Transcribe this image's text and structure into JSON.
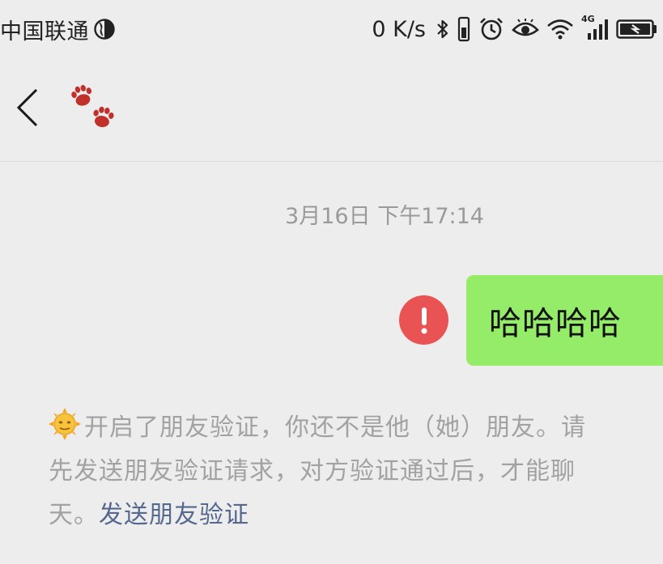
{
  "status_bar": {
    "carrier": "中国联通",
    "net_speed": "0 K/s",
    "network_type": "4G",
    "icons": [
      "globe-icon",
      "bluetooth-icon",
      "vibrate-icon",
      "alarm-icon",
      "eye-icon",
      "wifi-icon",
      "signal-icon",
      "battery-icon"
    ]
  },
  "header": {
    "back_icon": "chevron-left-icon",
    "title_icon": "paw-prints-icon"
  },
  "chat": {
    "timestamp": "3月16日 下午17:14",
    "outgoing_message": {
      "text": "哈哈哈哈",
      "status_icon": "error-exclamation-icon",
      "bubble_color": "#95ec69"
    },
    "system_message": {
      "emoji_icon": "sun-face-icon",
      "line1": "开启了朋友验证，你还不是他（她）朋友。请",
      "line2": "先发送朋友验证请求，对方验证通过后，才能聊",
      "line3_prefix": "天。",
      "link_text": "发送朋友验证"
    }
  },
  "colors": {
    "background": "#ededed",
    "error_red": "#ea5354",
    "link_blue": "#55688f",
    "timestamp_gray": "#9a9a9a"
  }
}
